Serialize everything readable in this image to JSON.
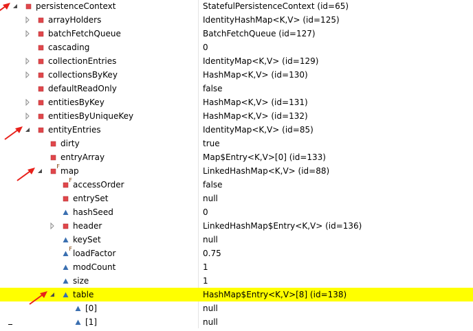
{
  "variables": [
    {
      "name": "persistenceContext",
      "value": "StatefulPersistenceContext  (id=65)",
      "depth": 0,
      "expander": "expanded",
      "icon": "field-private",
      "final": false,
      "selected": false,
      "arrow": true
    },
    {
      "name": "arrayHolders",
      "value": "IdentityHashMap<K,V>  (id=125)",
      "depth": 1,
      "expander": "collapsed",
      "icon": "field-private",
      "final": false,
      "selected": false,
      "arrow": false
    },
    {
      "name": "batchFetchQueue",
      "value": "BatchFetchQueue  (id=127)",
      "depth": 1,
      "expander": "collapsed",
      "icon": "field-private",
      "final": false,
      "selected": false,
      "arrow": false
    },
    {
      "name": "cascading",
      "value": "0",
      "depth": 1,
      "expander": "none",
      "icon": "field-private",
      "final": false,
      "selected": false,
      "arrow": false
    },
    {
      "name": "collectionEntries",
      "value": "IdentityMap<K,V>  (id=129)",
      "depth": 1,
      "expander": "collapsed",
      "icon": "field-private",
      "final": false,
      "selected": false,
      "arrow": false
    },
    {
      "name": "collectionsByKey",
      "value": "HashMap<K,V>  (id=130)",
      "depth": 1,
      "expander": "collapsed",
      "icon": "field-private",
      "final": false,
      "selected": false,
      "arrow": false
    },
    {
      "name": "defaultReadOnly",
      "value": "false",
      "depth": 1,
      "expander": "none",
      "icon": "field-private",
      "final": false,
      "selected": false,
      "arrow": false
    },
    {
      "name": "entitiesByKey",
      "value": "HashMap<K,V>  (id=131)",
      "depth": 1,
      "expander": "collapsed",
      "icon": "field-private",
      "final": false,
      "selected": false,
      "arrow": false
    },
    {
      "name": "entitiesByUniqueKey",
      "value": "HashMap<K,V>  (id=132)",
      "depth": 1,
      "expander": "collapsed",
      "icon": "field-private",
      "final": false,
      "selected": false,
      "arrow": false
    },
    {
      "name": "entityEntries",
      "value": "IdentityMap<K,V>  (id=85)",
      "depth": 1,
      "expander": "expanded",
      "icon": "field-private",
      "final": false,
      "selected": false,
      "arrow": true
    },
    {
      "name": "dirty",
      "value": "true",
      "depth": 2,
      "expander": "none",
      "icon": "field-private",
      "final": false,
      "selected": false,
      "arrow": false
    },
    {
      "name": "entryArray",
      "value": "Map$Entry<K,V>[0]  (id=133)",
      "depth": 2,
      "expander": "none",
      "icon": "field-private",
      "final": false,
      "selected": false,
      "arrow": false
    },
    {
      "name": "map",
      "value": "LinkedHashMap<K,V>  (id=88)",
      "depth": 2,
      "expander": "expanded",
      "icon": "field-private",
      "final": true,
      "selected": false,
      "arrow": true
    },
    {
      "name": "accessOrder",
      "value": "false",
      "depth": 3,
      "expander": "none",
      "icon": "field-private",
      "final": true,
      "selected": false,
      "arrow": false
    },
    {
      "name": "entrySet",
      "value": "null",
      "depth": 3,
      "expander": "none",
      "icon": "field-private",
      "final": false,
      "selected": false,
      "arrow": false
    },
    {
      "name": "hashSeed",
      "value": "0",
      "depth": 3,
      "expander": "none",
      "icon": "field-package",
      "final": false,
      "selected": false,
      "arrow": false
    },
    {
      "name": "header",
      "value": "LinkedHashMap$Entry<K,V>  (id=136)",
      "depth": 3,
      "expander": "collapsed",
      "icon": "field-private",
      "final": false,
      "selected": false,
      "arrow": false
    },
    {
      "name": "keySet",
      "value": "null",
      "depth": 3,
      "expander": "none",
      "icon": "field-package",
      "final": false,
      "selected": false,
      "arrow": false
    },
    {
      "name": "loadFactor",
      "value": "0.75",
      "depth": 3,
      "expander": "none",
      "icon": "field-package",
      "final": true,
      "selected": false,
      "arrow": false
    },
    {
      "name": "modCount",
      "value": "1",
      "depth": 3,
      "expander": "none",
      "icon": "field-package",
      "final": false,
      "selected": false,
      "arrow": false
    },
    {
      "name": "size",
      "value": "1",
      "depth": 3,
      "expander": "none",
      "icon": "field-package",
      "final": false,
      "selected": false,
      "arrow": false
    },
    {
      "name": "table",
      "value": "HashMap$Entry<K,V>[8]  (id=138)",
      "depth": 3,
      "expander": "expanded",
      "icon": "field-package",
      "final": false,
      "selected": true,
      "arrow": true
    },
    {
      "name": "[0]",
      "value": "null",
      "depth": 4,
      "expander": "none",
      "icon": "field-package",
      "final": false,
      "selected": false,
      "arrow": false
    },
    {
      "name": "[1]",
      "value": "null",
      "depth": 4,
      "expander": "none",
      "icon": "field-package",
      "final": false,
      "selected": false,
      "arrow": false
    }
  ],
  "colors": {
    "selection": "#ffff00",
    "private_icon": "#e0474c",
    "package_icon": "#3a6fb0",
    "annotation_arrow": "#e8201a",
    "expander": "#6b6b6b"
  }
}
